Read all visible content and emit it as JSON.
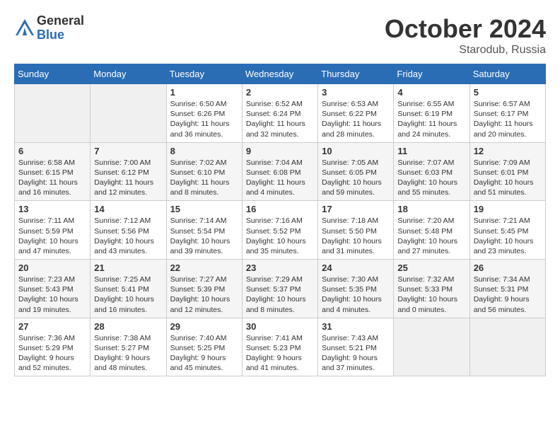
{
  "header": {
    "logo": {
      "general": "General",
      "blue": "Blue"
    },
    "title": "October 2024",
    "subtitle": "Starodub, Russia"
  },
  "weekdays": [
    "Sunday",
    "Monday",
    "Tuesday",
    "Wednesday",
    "Thursday",
    "Friday",
    "Saturday"
  ],
  "weeks": [
    [
      {
        "day": null
      },
      {
        "day": null
      },
      {
        "day": "1",
        "sunrise": "6:50 AM",
        "sunset": "6:26 PM",
        "daylight": "11 hours and 36 minutes."
      },
      {
        "day": "2",
        "sunrise": "6:52 AM",
        "sunset": "6:24 PM",
        "daylight": "11 hours and 32 minutes."
      },
      {
        "day": "3",
        "sunrise": "6:53 AM",
        "sunset": "6:22 PM",
        "daylight": "11 hours and 28 minutes."
      },
      {
        "day": "4",
        "sunrise": "6:55 AM",
        "sunset": "6:19 PM",
        "daylight": "11 hours and 24 minutes."
      },
      {
        "day": "5",
        "sunrise": "6:57 AM",
        "sunset": "6:17 PM",
        "daylight": "11 hours and 20 minutes."
      }
    ],
    [
      {
        "day": "6",
        "sunrise": "6:58 AM",
        "sunset": "6:15 PM",
        "daylight": "11 hours and 16 minutes."
      },
      {
        "day": "7",
        "sunrise": "7:00 AM",
        "sunset": "6:12 PM",
        "daylight": "11 hours and 12 minutes."
      },
      {
        "day": "8",
        "sunrise": "7:02 AM",
        "sunset": "6:10 PM",
        "daylight": "11 hours and 8 minutes."
      },
      {
        "day": "9",
        "sunrise": "7:04 AM",
        "sunset": "6:08 PM",
        "daylight": "11 hours and 4 minutes."
      },
      {
        "day": "10",
        "sunrise": "7:05 AM",
        "sunset": "6:05 PM",
        "daylight": "10 hours and 59 minutes."
      },
      {
        "day": "11",
        "sunrise": "7:07 AM",
        "sunset": "6:03 PM",
        "daylight": "10 hours and 55 minutes."
      },
      {
        "day": "12",
        "sunrise": "7:09 AM",
        "sunset": "6:01 PM",
        "daylight": "10 hours and 51 minutes."
      }
    ],
    [
      {
        "day": "13",
        "sunrise": "7:11 AM",
        "sunset": "5:59 PM",
        "daylight": "10 hours and 47 minutes."
      },
      {
        "day": "14",
        "sunrise": "7:12 AM",
        "sunset": "5:56 PM",
        "daylight": "10 hours and 43 minutes."
      },
      {
        "day": "15",
        "sunrise": "7:14 AM",
        "sunset": "5:54 PM",
        "daylight": "10 hours and 39 minutes."
      },
      {
        "day": "16",
        "sunrise": "7:16 AM",
        "sunset": "5:52 PM",
        "daylight": "10 hours and 35 minutes."
      },
      {
        "day": "17",
        "sunrise": "7:18 AM",
        "sunset": "5:50 PM",
        "daylight": "10 hours and 31 minutes."
      },
      {
        "day": "18",
        "sunrise": "7:20 AM",
        "sunset": "5:48 PM",
        "daylight": "10 hours and 27 minutes."
      },
      {
        "day": "19",
        "sunrise": "7:21 AM",
        "sunset": "5:45 PM",
        "daylight": "10 hours and 23 minutes."
      }
    ],
    [
      {
        "day": "20",
        "sunrise": "7:23 AM",
        "sunset": "5:43 PM",
        "daylight": "10 hours and 19 minutes."
      },
      {
        "day": "21",
        "sunrise": "7:25 AM",
        "sunset": "5:41 PM",
        "daylight": "10 hours and 16 minutes."
      },
      {
        "day": "22",
        "sunrise": "7:27 AM",
        "sunset": "5:39 PM",
        "daylight": "10 hours and 12 minutes."
      },
      {
        "day": "23",
        "sunrise": "7:29 AM",
        "sunset": "5:37 PM",
        "daylight": "10 hours and 8 minutes."
      },
      {
        "day": "24",
        "sunrise": "7:30 AM",
        "sunset": "5:35 PM",
        "daylight": "10 hours and 4 minutes."
      },
      {
        "day": "25",
        "sunrise": "7:32 AM",
        "sunset": "5:33 PM",
        "daylight": "10 hours and 0 minutes."
      },
      {
        "day": "26",
        "sunrise": "7:34 AM",
        "sunset": "5:31 PM",
        "daylight": "9 hours and 56 minutes."
      }
    ],
    [
      {
        "day": "27",
        "sunrise": "7:36 AM",
        "sunset": "5:29 PM",
        "daylight": "9 hours and 52 minutes."
      },
      {
        "day": "28",
        "sunrise": "7:38 AM",
        "sunset": "5:27 PM",
        "daylight": "9 hours and 48 minutes."
      },
      {
        "day": "29",
        "sunrise": "7:40 AM",
        "sunset": "5:25 PM",
        "daylight": "9 hours and 45 minutes."
      },
      {
        "day": "30",
        "sunrise": "7:41 AM",
        "sunset": "5:23 PM",
        "daylight": "9 hours and 41 minutes."
      },
      {
        "day": "31",
        "sunrise": "7:43 AM",
        "sunset": "5:21 PM",
        "daylight": "9 hours and 37 minutes."
      },
      {
        "day": null
      },
      {
        "day": null
      }
    ]
  ]
}
